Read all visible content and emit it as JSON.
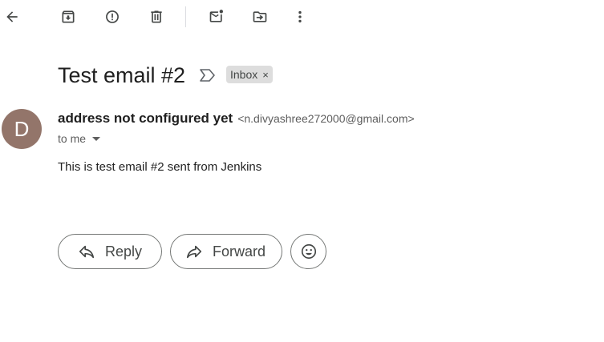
{
  "toolbar": {
    "back": "back-arrow-icon",
    "archive": "archive-icon",
    "spam": "report-spam-icon",
    "delete": "trash-icon",
    "mark_unread": "mark-unread-icon",
    "move_to": "move-to-icon",
    "more": "more-vert-icon"
  },
  "message": {
    "subject": "Test email #2",
    "label": "Inbox",
    "label_remove": "×",
    "sender": {
      "initial": "D",
      "name": "address not configured yet",
      "email": "<n.divyashree272000@gmail.com>"
    },
    "recipient_text": "to me",
    "body": "This is test email #2 sent from Jenkins"
  },
  "actions": {
    "reply_label": "Reply",
    "forward_label": "Forward"
  },
  "colors": {
    "avatar_bg": "#93756a",
    "chip_bg": "#dddddd",
    "icon": "#444746"
  }
}
